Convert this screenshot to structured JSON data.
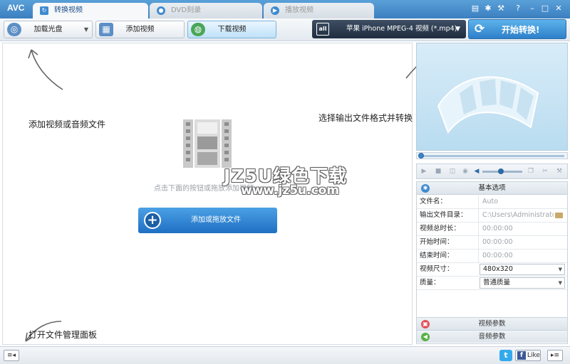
{
  "app": {
    "logo": "AVC"
  },
  "tabs": [
    {
      "label": "转换视频",
      "active": true,
      "icon": "convert-icon"
    },
    {
      "label": "DVD刻录",
      "active": false,
      "icon": "disc-icon"
    },
    {
      "label": "播放视频",
      "active": false,
      "icon": "play-icon"
    }
  ],
  "window_controls": {
    "icons": [
      "report-icon",
      "gear-icon",
      "wrench-icon",
      "help-icon",
      "minimize-icon",
      "maximize-icon",
      "close-icon"
    ],
    "help_label": "?"
  },
  "toolbar": {
    "load_disc": "加载光盘",
    "add_video": "添加视频",
    "download_video": "下载视频",
    "format_selected": "苹果 iPhone MPEG-4 视频 (*.mp4)",
    "format_icon_text": "all",
    "convert": "开始转换!"
  },
  "main": {
    "annot_add": "添加视频或音频文件",
    "annot_output": "选择输出文件格式并转换",
    "annot_panel": "打开文件管理面板",
    "hint": "点击下面的按钮或拖放添加视频",
    "watermark_title": "JZ5U绿色下载",
    "watermark_url": "www.jz5u.com",
    "add_button": "添加或拖放文件"
  },
  "properties": {
    "header": "基本选项",
    "rows": [
      {
        "key": "文件名：",
        "value": "Auto"
      },
      {
        "key": "输出文件目录：",
        "value": "C:\\Users\\Administrator..."
      },
      {
        "key": "视频总时长：",
        "value": "00:00:00"
      },
      {
        "key": "开始时间：",
        "value": "00:00:00"
      },
      {
        "key": "结束时间：",
        "value": "00:00:00"
      },
      {
        "key": "视频尺寸：",
        "value": "480x320"
      },
      {
        "key": "质量：",
        "value": "普通质量"
      }
    ],
    "video_params": "视频参数",
    "audio_params": "音频参数"
  },
  "statusbar": {
    "facebook_like": "Like"
  },
  "colors": {
    "titlebar": "#3b7fc0",
    "accent": "#2e80c9",
    "format_bar": "#1f2d3f"
  }
}
